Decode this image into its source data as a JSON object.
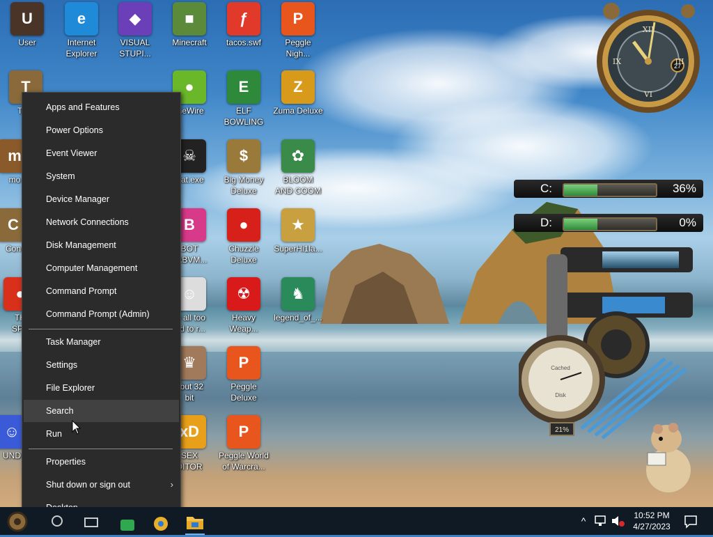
{
  "desktop_icons": [
    {
      "label": "User",
      "glyph": "U",
      "color": "#4a3428",
      "icon": "user-folder-icon"
    },
    {
      "label": "Internet\nExplorer",
      "glyph": "e",
      "color": "#1f8ad8",
      "icon": "edge-icon"
    },
    {
      "label": "VISUAL\nSTUPI...",
      "glyph": "◆",
      "color": "#6b3fb8",
      "icon": "visual-studio-icon"
    },
    {
      "label": "Minecraft",
      "glyph": "■",
      "color": "#5b8a3a",
      "icon": "minecraft-icon"
    },
    {
      "label": "tacos.swf",
      "glyph": "ƒ",
      "color": "#e23a2a",
      "icon": "flash-file-icon"
    },
    {
      "label": "Peggle\nNigh...",
      "glyph": "P",
      "color": "#e8561e",
      "icon": "peggle-icon"
    },
    {
      "label": "Th...",
      "glyph": "T",
      "color": "#8a6a3a",
      "icon": "folder-icon"
    },
    {
      "label": "meWire",
      "glyph": "●",
      "color": "#6ab82a",
      "icon": "limewire-icon"
    },
    {
      "label": "ELF\nBOWLING",
      "glyph": "E",
      "color": "#2e8a3a",
      "icon": "elf-bowling-icon"
    },
    {
      "label": "Zuma Deluxe",
      "glyph": "Z",
      "color": "#d89a1a",
      "icon": "zuma-icon"
    },
    {
      "label": "Rat.exe",
      "glyph": "☠",
      "color": "#222222",
      "icon": "skull-icon"
    },
    {
      "label": "Big Money\nDeluxe",
      "glyph": "$",
      "color": "#9a7a3a",
      "icon": "money-bag-icon"
    },
    {
      "label": "BLOOM\nAND COOM",
      "glyph": "✿",
      "color": "#3a8a4a",
      "icon": "flower-icon"
    },
    {
      "label": "BOT\nLABVM...",
      "glyph": "B",
      "color": "#d83a8a",
      "icon": "bot-icon"
    },
    {
      "label": "Chuzzle\nDeluxe",
      "glyph": "●",
      "color": "#d8201a",
      "icon": "chuzzle-icon"
    },
    {
      "label": "SuperHi1la...",
      "glyph": "★",
      "color": "#c8a040",
      "icon": "pixel-dog-icon"
    },
    {
      "label": "re all too\npid to r...",
      "glyph": "☺",
      "color": "#dddddd",
      "icon": "face-icon"
    },
    {
      "label": "Heavy\nWeap...",
      "glyph": "☢",
      "color": "#d81a1a",
      "icon": "radiation-icon"
    },
    {
      "label": "legend_of_...",
      "glyph": "♞",
      "color": "#2a8a5a",
      "icon": "pixel-hero-icon"
    },
    {
      "label": "t but 32\nbit",
      "glyph": "♛",
      "color": "#a07a5a",
      "icon": "portrait-icon"
    },
    {
      "label": "Peggle\nDeluxe",
      "glyph": "P",
      "color": "#e8561e",
      "icon": "peggle-icon"
    },
    {
      "label": "SEX\nDITOR",
      "glyph": "xD",
      "color": "#e8a01a",
      "icon": "xd-icon"
    },
    {
      "label": "Peggle World\nof Warcra...",
      "glyph": "P",
      "color": "#e8561e",
      "icon": "peggle-icon"
    },
    {
      "label": "TH\nSPY",
      "glyph": "●",
      "color": "#d8301a",
      "icon": "chrome-icon"
    },
    {
      "label": "mo",
      "glyph": "m",
      "color": "#8a5a2a",
      "icon": "folder-icon"
    },
    {
      "label": "Con",
      "glyph": "C",
      "color": "#8a6a3a",
      "icon": "folder-icon"
    },
    {
      "label": "UND",
      "glyph": "☺",
      "color": "#3a5ad8",
      "icon": "character-icon"
    }
  ],
  "menu": {
    "group1": [
      "Apps and Features",
      "Power Options",
      "Event Viewer",
      "System",
      "Device Manager",
      "Network Connections",
      "Disk Management",
      "Computer Management",
      "Command Prompt",
      "Command Prompt (Admin)"
    ],
    "group2": [
      "Task Manager",
      "Settings",
      "File Explorer",
      "Search",
      "Run"
    ],
    "group3": [
      "Properties",
      "Shut down or sign out",
      "Desktop"
    ],
    "hovered": "Search",
    "submenu_chevron": "›"
  },
  "widgets": {
    "clock_day": "27",
    "drives": [
      {
        "label": "C:",
        "percent_text": "36%",
        "fill": 0.36
      },
      {
        "label": "D:",
        "percent_text": "0%",
        "fill": 0.0
      }
    ],
    "gauge_label_top": "Cached",
    "gauge_label_bottom": "Disk",
    "gauge_readout": "21%"
  },
  "taskbar": {
    "time": "10:52 PM",
    "date": "4/27/2023",
    "tray_chevron": "^"
  },
  "colors": {
    "menu_bg": "#2b2b2b",
    "menu_hover": "#414141",
    "taskbar_bg": "#101a24",
    "drive_fill": "#4caf50"
  }
}
